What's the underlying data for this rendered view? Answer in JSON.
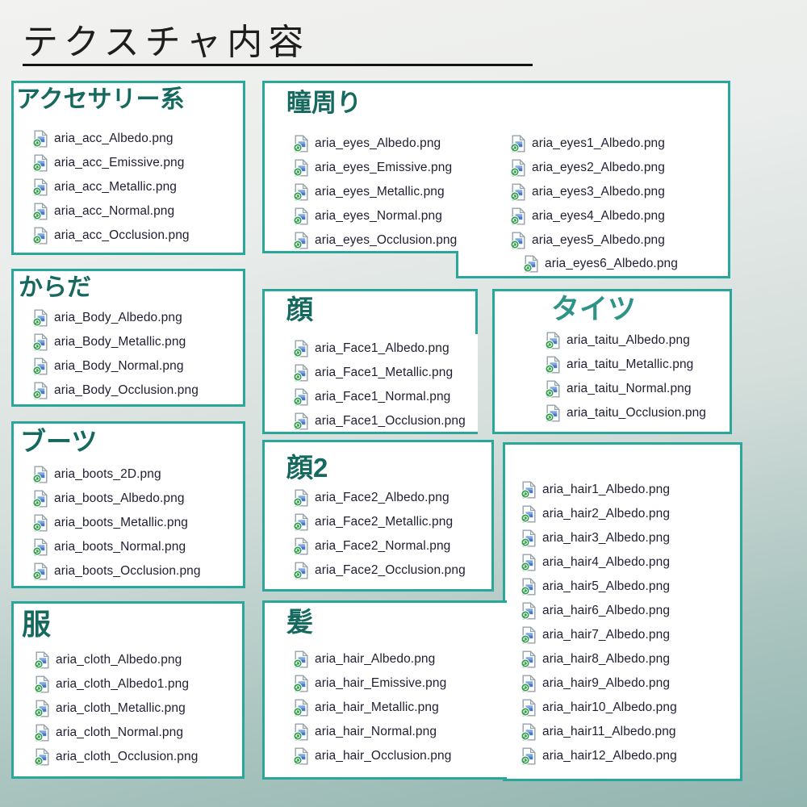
{
  "page_title": "テクスチャ内容",
  "colors": {
    "box_border": "#2aa79b",
    "section_header": "#15695e",
    "tights_header": "#2f9488",
    "file_text": "#1f1f33",
    "background_top": "#f2f2f0",
    "background_bottom": "#93b5b0",
    "title_underline": "#141414",
    "icon_badge_green": "#2f9e49",
    "icon_image_blue": "#4a77c9"
  },
  "sections": {
    "accessory": {
      "title": "アクセサリー系",
      "files": [
        "aria_acc_Albedo.png",
        "aria_acc_Emissive.png",
        "aria_acc_Metallic.png",
        "aria_acc_Normal.png",
        "aria_acc_Occlusion.png"
      ]
    },
    "eyes": {
      "title": "瞳周り",
      "files_col1": [
        "aria_eyes_Albedo.png",
        "aria_eyes_Emissive.png",
        "aria_eyes_Metallic.png",
        "aria_eyes_Normal.png",
        "aria_eyes_Occlusion.png"
      ],
      "files_col2": [
        "aria_eyes1_Albedo.png",
        "aria_eyes2_Albedo.png",
        "aria_eyes3_Albedo.png",
        "aria_eyes4_Albedo.png",
        "aria_eyes5_Albedo.png"
      ],
      "files_ext": [
        "aria_eyes6_Albedo.png"
      ]
    },
    "body": {
      "title": "からだ",
      "files": [
        "aria_Body_Albedo.png",
        "aria_Body_Metallic.png",
        "aria_Body_Normal.png",
        "aria_Body_Occlusion.png"
      ]
    },
    "face1": {
      "title": "顔",
      "files": [
        "aria_Face1_Albedo.png",
        "aria_Face1_Metallic.png",
        "aria_Face1_Normal.png",
        "aria_Face1_Occlusion.png"
      ]
    },
    "tights": {
      "title": "タイツ",
      "files": [
        "aria_taitu_Albedo.png",
        "aria_taitu_Metallic.png",
        "aria_taitu_Normal.png",
        "aria_taitu_Occlusion.png"
      ]
    },
    "boots": {
      "title": "ブーツ",
      "files": [
        "aria_boots_2D.png",
        "aria_boots_Albedo.png",
        "aria_boots_Metallic.png",
        "aria_boots_Normal.png",
        "aria_boots_Occlusion.png"
      ]
    },
    "face2": {
      "title": "顔2",
      "files": [
        "aria_Face2_Albedo.png",
        "aria_Face2_Metallic.png",
        "aria_Face2_Normal.png",
        "aria_Face2_Occlusion.png"
      ]
    },
    "hair_numbered": {
      "title": "",
      "files": [
        "aria_hair1_Albedo.png",
        "aria_hair2_Albedo.png",
        "aria_hair3_Albedo.png",
        "aria_hair4_Albedo.png",
        "aria_hair5_Albedo.png",
        "aria_hair6_Albedo.png",
        "aria_hair7_Albedo.png",
        "aria_hair8_Albedo.png",
        "aria_hair9_Albedo.png",
        "aria_hair10_Albedo.png",
        "aria_hair11_Albedo.png",
        "aria_hair12_Albedo.png"
      ]
    },
    "clothes": {
      "title": "服",
      "files": [
        "aria_cloth_Albedo.png",
        "aria_cloth_Albedo1.png",
        "aria_cloth_Metallic.png",
        "aria_cloth_Normal.png",
        "aria_cloth_Occlusion.png"
      ]
    },
    "hair": {
      "title": "髪",
      "files": [
        "aria_hair_Albedo.png",
        "aria_hair_Emissive.png",
        "aria_hair_Metallic.png",
        "aria_hair_Normal.png",
        "aria_hair_Occlusion.png"
      ]
    }
  }
}
